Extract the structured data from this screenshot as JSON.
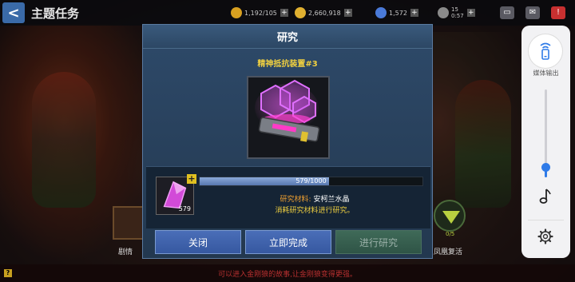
{
  "header": {
    "back_glyph": "<",
    "title": "主题任务",
    "resources": [
      {
        "icon": "energy-icon",
        "color": "#d8a020",
        "value": "1,192/105"
      },
      {
        "icon": "gold-coin-icon",
        "color": "#e0b030",
        "value": "2,660,918"
      },
      {
        "icon": "crystal-icon",
        "color": "#4a7ad8",
        "value": "1,572"
      },
      {
        "icon": "timer-icon",
        "color": "#8a8a8a",
        "value": "15",
        "sub": "0:57"
      }
    ]
  },
  "side": {
    "left_label": "剧情",
    "right_label": "凤凰复活",
    "right_badge_text": "0/5"
  },
  "modal": {
    "title": "研究",
    "item_name": "精神抵抗装置#3",
    "progress": {
      "current": 579,
      "max": 1000,
      "text": "579/1000"
    },
    "material_count": "579",
    "material_label": "研究材料:",
    "material_name": "安柯兰水晶",
    "hint": "消耗研究材料进行研究。",
    "buttons": {
      "close": "关闭",
      "instant": "立即完成",
      "research": "进行研究"
    }
  },
  "ticker": {
    "help": "?",
    "text": "可以进入金刚狼的故事,让金刚狼变得更强。"
  },
  "media_panel": {
    "cast_label": "媒体输出",
    "volume_level": 0.12
  }
}
